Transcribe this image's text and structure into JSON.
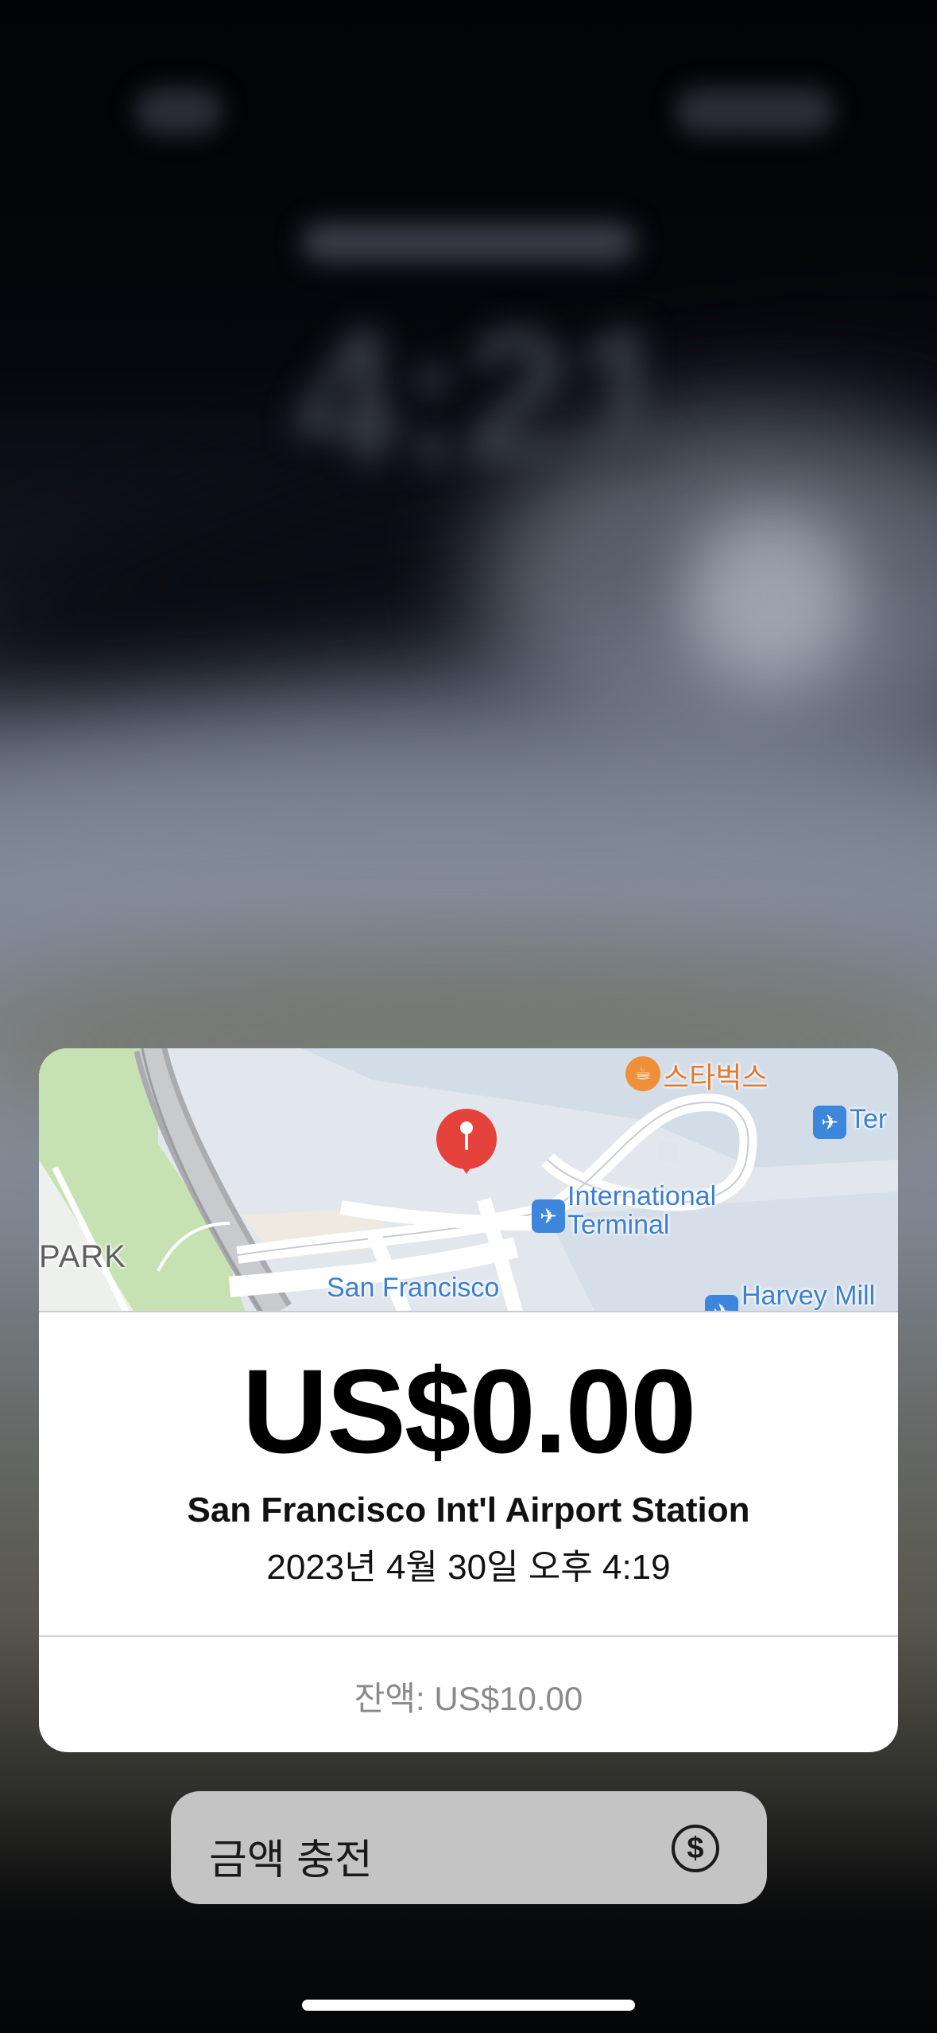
{
  "map": {
    "starbucks_label": "스타벅스",
    "international_terminal_label": "International\nTerminal",
    "terminal_label": "Ter",
    "sf_label": "San Francisco",
    "harvey_label": "Harvey Mill",
    "park_label": "PARK",
    "pin_icon": "location-pin-icon"
  },
  "transaction": {
    "amount": "US$0.00",
    "station": "San Francisco Int'l Airport Station",
    "datetime": "2023년 4월 30일 오후 4:19",
    "balance": "잔액: US$10.00"
  },
  "topup": {
    "label": "금액 충전",
    "icon": "dollar-circle-icon"
  }
}
